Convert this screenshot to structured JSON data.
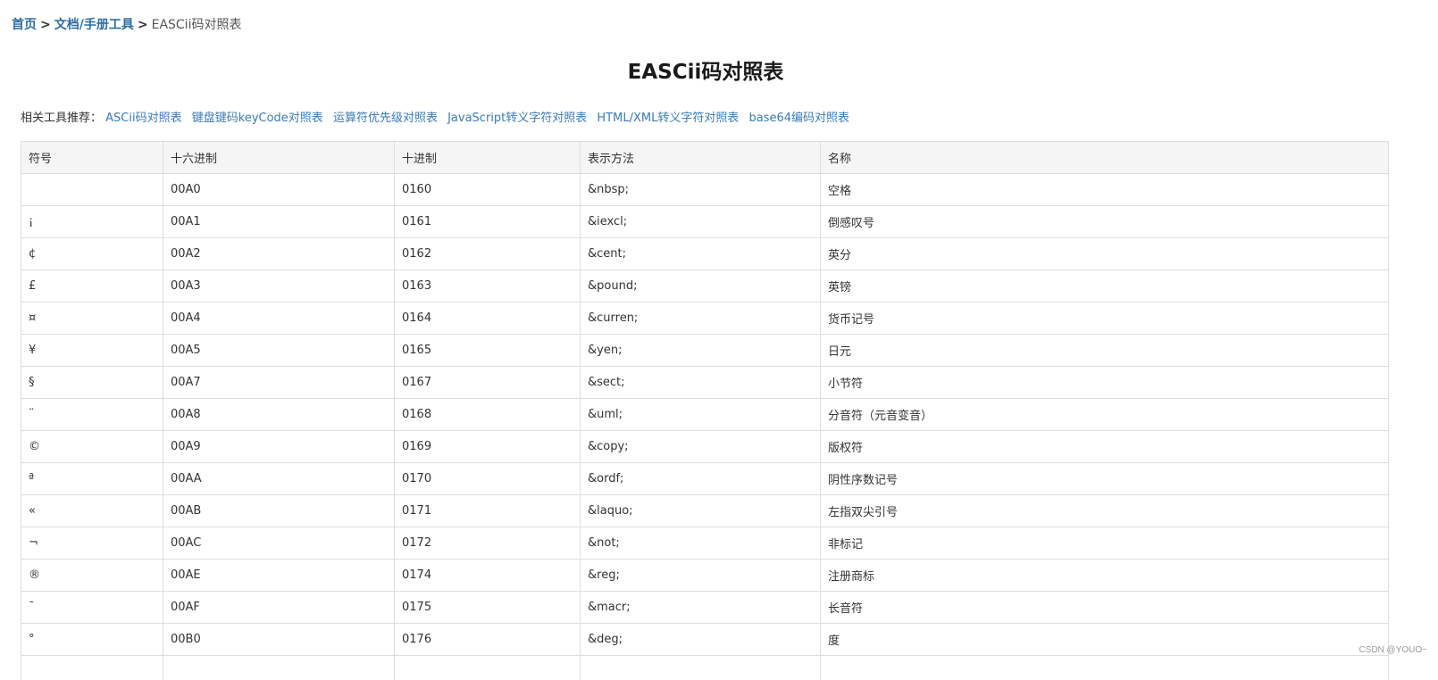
{
  "breadcrumb": {
    "home": "首页",
    "sep1": ">",
    "docs": "文档/手册工具",
    "sep2": ">",
    "current": "EASCii码对照表"
  },
  "title": "EASCii码对照表",
  "related": {
    "label": "相关工具推荐：",
    "links": [
      "ASCii码对照表",
      "键盘键码keyCode对照表",
      "运算符优先级对照表",
      "JavaScript转义字符对照表",
      "HTML/XML转义字符对照表",
      "base64编码对照表"
    ]
  },
  "table": {
    "headers": [
      "符号",
      "十六进制",
      "十进制",
      "表示方法",
      "名称"
    ],
    "rows": [
      [
        "",
        "00A0",
        "0160",
        "&nbsp;",
        "空格"
      ],
      [
        "¡",
        "00A1",
        "0161",
        "&iexcl;",
        "倒感叹号"
      ],
      [
        "¢",
        "00A2",
        "0162",
        "&cent;",
        "英分"
      ],
      [
        "£",
        "00A3",
        "0163",
        "&pound;",
        "英镑"
      ],
      [
        "¤",
        "00A4",
        "0164",
        "&curren;",
        "货币记号"
      ],
      [
        "¥",
        "00A5",
        "0165",
        "&yen;",
        "日元"
      ],
      [
        "§",
        "00A7",
        "0167",
        "&sect;",
        "小节符"
      ],
      [
        "¨",
        "00A8",
        "0168",
        "&uml;",
        "分音符（元音变音）"
      ],
      [
        "©",
        "00A9",
        "0169",
        "&copy;",
        "版权符"
      ],
      [
        "ª",
        "00AA",
        "0170",
        "&ordf;",
        "阴性序数记号"
      ],
      [
        "«",
        "00AB",
        "0171",
        "&laquo;",
        "左指双尖引号"
      ],
      [
        "¬",
        "00AC",
        "0172",
        "&not;",
        "非标记"
      ],
      [
        "®",
        "00AE",
        "0174",
        "&reg;",
        "注册商标"
      ],
      [
        "¯",
        "00AF",
        "0175",
        "&macr;",
        "长音符"
      ],
      [
        "°",
        "00B0",
        "0176",
        "&deg;",
        "度"
      ],
      [
        "",
        "",
        "",
        "",
        ""
      ]
    ]
  },
  "watermark": "CSDN @YOUO~"
}
